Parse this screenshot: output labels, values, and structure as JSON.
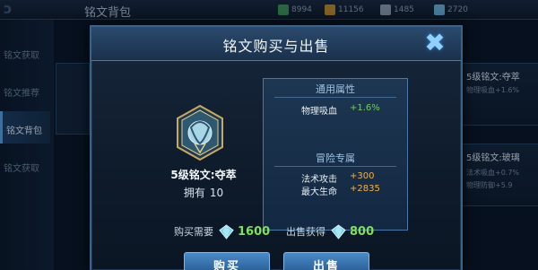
{
  "background": {
    "screen_title": "铭文背包",
    "resources": [
      "8994",
      "11156",
      "1485",
      "2720"
    ],
    "sidebar": [
      {
        "label": "铭文获取"
      },
      {
        "label": "铭文推荐"
      },
      {
        "label": "铭文背包",
        "active": true
      },
      {
        "label": "铭文获取"
      }
    ],
    "right_cards": [
      {
        "title": "5级铭文:夺萃",
        "lines": [
          "物理吸血+1.6%"
        ]
      },
      {
        "title": "5级铭文:玻璃",
        "lines": [
          "法术吸血+0.7%",
          "物理防御+5.9"
        ]
      }
    ]
  },
  "dialog": {
    "title": "铭文购买与出售",
    "close_glyph": "✖",
    "item": {
      "name": "5级铭文:夺萃",
      "owned_label": "拥有",
      "owned_count": "10"
    },
    "general": {
      "title": "通用属性",
      "attrs": [
        {
          "name": "物理吸血",
          "value": "+1.6%"
        }
      ]
    },
    "adventure": {
      "title": "冒险专属",
      "attrs": [
        {
          "name": "法术攻击",
          "value": "+300"
        },
        {
          "name": "最大生命",
          "value": "+2835"
        }
      ]
    },
    "buy_cost_label": "购买需要",
    "buy_cost_value": "1600",
    "sell_label": "出售获得",
    "sell_value": "800",
    "buy_button": "购买",
    "sell_button": "出售"
  },
  "colors": {
    "accent": "#4a8bc9",
    "positive": "#6fd35a",
    "highlight": "#f0b248",
    "gem": "#7fd4e8"
  }
}
